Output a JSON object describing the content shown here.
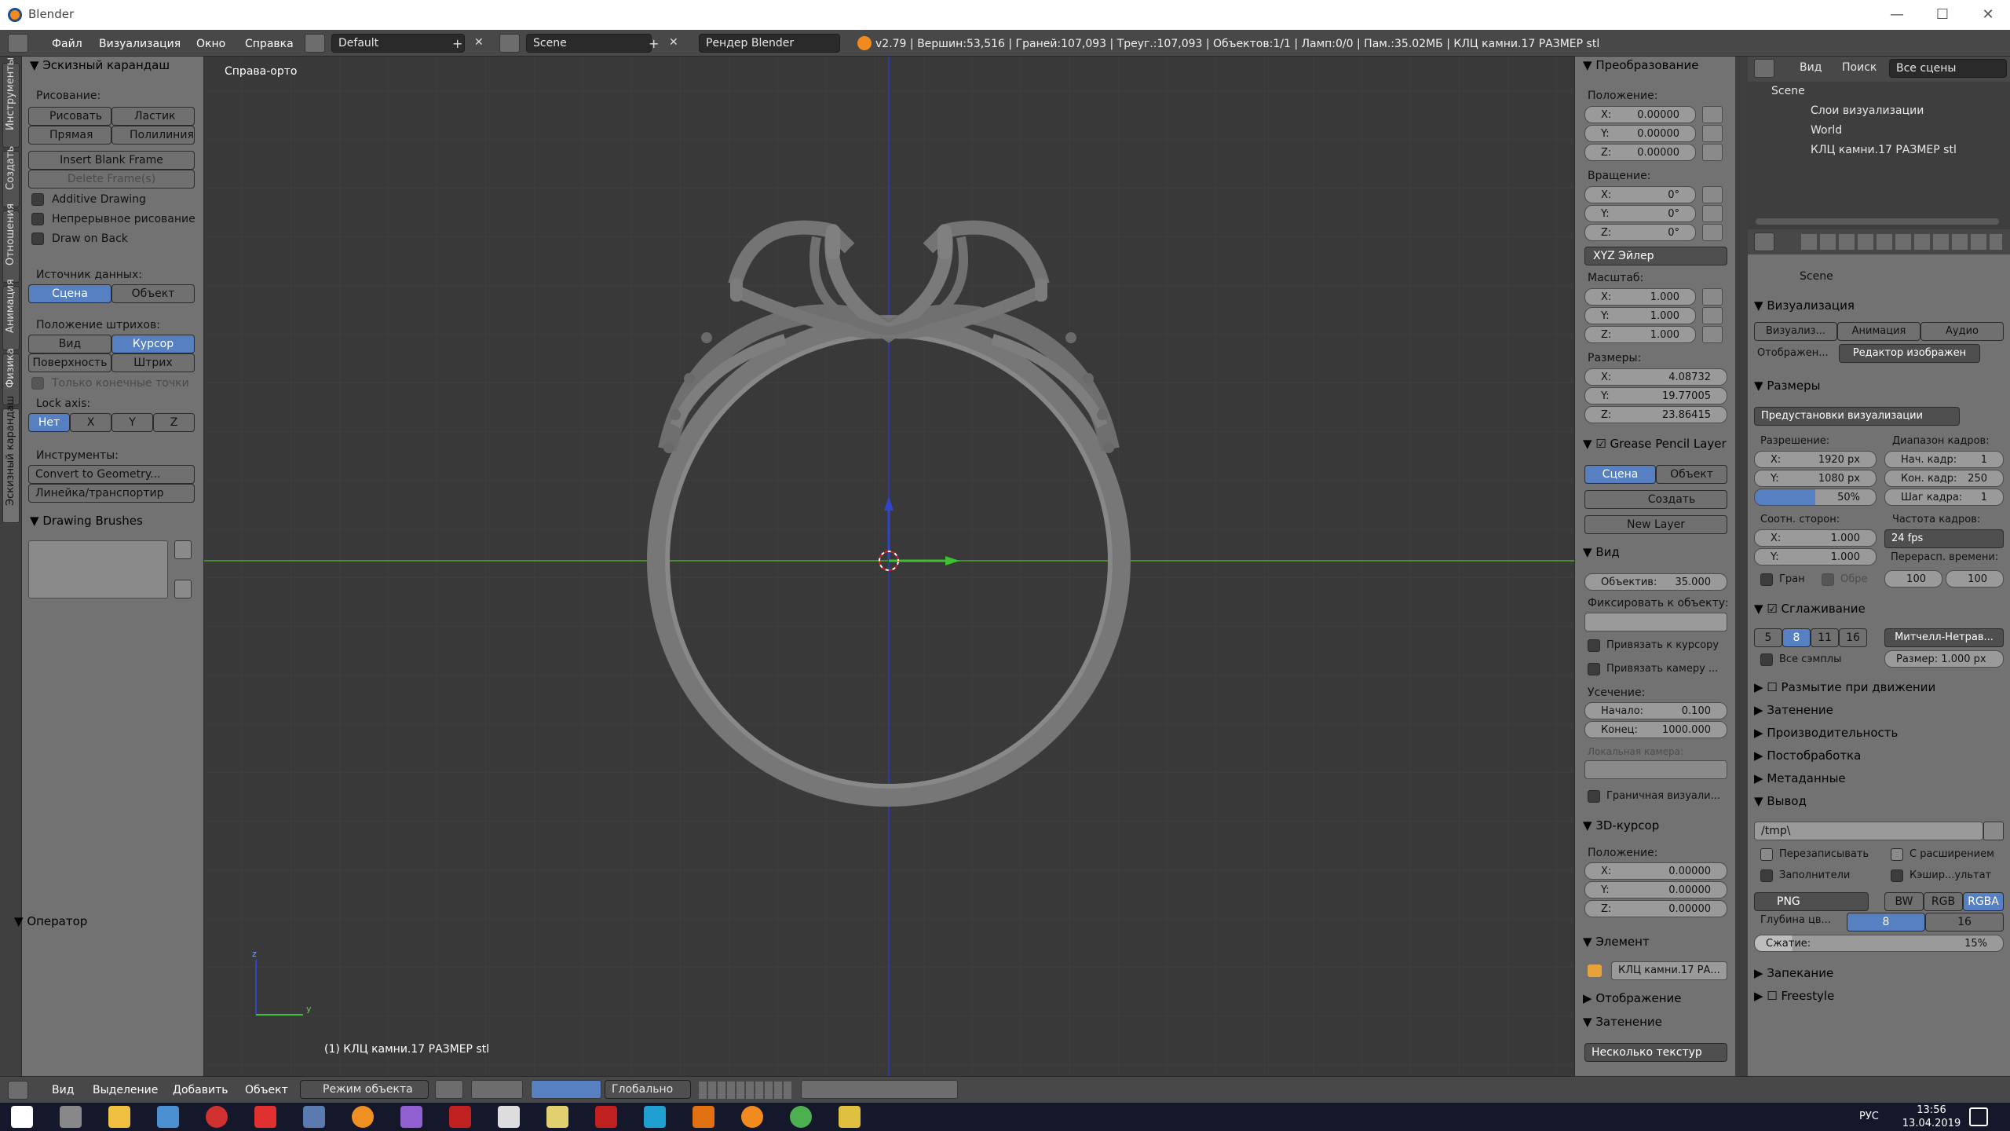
{
  "window": {
    "title": "Blender",
    "min": "—",
    "max": "☐",
    "close": "✕"
  },
  "menu": {
    "file": "Файл",
    "render": "Визуализация",
    "window": "Окно",
    "help": "Справка"
  },
  "layout": "Default",
  "scene": "Scene",
  "engine": "Рендер Blender",
  "stats": "v2.79 | Вершин:53,516 | Граней:107,093 | Треуг.:107,093 | Объектов:1/1 | Ламп:0/0 | Пам.:35.02МБ | КЛЦ камни.17 РАЗМЕР stl",
  "tabs": [
    "Инструменты",
    "Создать",
    "Отношения",
    "Анимация",
    "Физика",
    "Эскизный карандаш"
  ],
  "left": {
    "panel_title": "Эскизный карандаш",
    "draw_label": "Рисование:",
    "draw": "Рисовать",
    "erase": "Ластик",
    "line": "Прямая",
    "poly": "Полилиния",
    "insert": "Insert Blank Frame",
    "delete": "Delete Frame(s)",
    "additive": "Additive Drawing",
    "continuous": "Непрерывное рисование",
    "drawback": "Draw on Back",
    "src_label": "Источник данных:",
    "scene": "Сцена",
    "object": "Объект",
    "stroke_label": "Положение штрихов:",
    "view": "Вид",
    "cursor": "Курсор",
    "surface": "Поверхность",
    "stroke": "Штрих",
    "endpoints": "Только конечные точки",
    "lock_label": "Lock axis:",
    "none": "Нет",
    "x": "X",
    "y": "Y",
    "z": "Z",
    "tools_label": "Инструменты:",
    "convert": "Convert to Geometry...",
    "ruler": "Линейка/транспортир",
    "brushes": "Drawing Brushes",
    "operator": "Оператор"
  },
  "viewport": {
    "view_name": "Справа-орто",
    "object_label": "(1) КЛЦ камни.17 РАЗМЕР stl",
    "axis_z": "z",
    "axis_y": "y"
  },
  "n": {
    "transform": "Преобразование",
    "location": "Положение:",
    "lx": "0.00000",
    "ly": "0.00000",
    "lz": "0.00000",
    "rotation": "Вращение:",
    "rx": "0°",
    "ry": "0°",
    "rz": "0°",
    "rotmode": "XYZ Эйлер",
    "scale": "Масштаб:",
    "sx": "1.000",
    "sy": "1.000",
    "sz": "1.000",
    "dims": "Размеры:",
    "dx": "4.08732",
    "dy": "19.77005",
    "dz": "23.86415",
    "gp": "Grease Pencil Layer",
    "scene": "Сцена",
    "object": "Объект",
    "create": "Создать",
    "newlayer": "New Layer",
    "view": "Вид",
    "lens": "Объектив:",
    "lensv": "35.000",
    "lockobj": "Фиксировать к объекту:",
    "lockcursor": "Привязать к курсору",
    "lockcam": "Привязать камеру ...",
    "clip": "Усечение:",
    "start": "Начало:",
    "startv": "0.100",
    "end": "Конец:",
    "endv": "1000.000",
    "localcam": "Локальная камера:",
    "border": "Граничная визуали...",
    "cursor3d": "3D-курсор",
    "cloc": "Положение:",
    "cx": "0.00000",
    "cy": "0.00000",
    "cz": "0.00000",
    "item": "Элемент",
    "itemname": "КЛЦ камни.17 РА...",
    "display": "Отображение",
    "shading": "Затенение",
    "textures": "Несколько текстур",
    "X": "X:",
    "Y": "Y:",
    "Z": "Z:"
  },
  "outliner": {
    "view": "Вид",
    "search": "Поиск",
    "allscenes": "Все сцены",
    "scene": "Scene",
    "layers": "Слои визуализации",
    "world": "World",
    "obj": "КЛЦ камни.17 РАЗМЕР stl"
  },
  "props": {
    "scene": "Scene",
    "render": "Визуализация",
    "render_btn": "Визуализ...",
    "anim_btn": "Анимация",
    "audio_btn": "Аудио",
    "display": "Отображен...",
    "editor": "Редактор изображен",
    "dims": "Размеры",
    "presets": "Предустановки визуализации",
    "res": "Разрешение:",
    "resx": "1920 px",
    "resy": "1080 px",
    "pct": "50%",
    "frange": "Диапазон кадров:",
    "fstart": "Нач. кадр:",
    "fstartv": "1",
    "fend": "Кон. кадр:",
    "fendv": "250",
    "fstep": "Шаг кадра:",
    "fstepv": "1",
    "aspect": "Соотн. сторон:",
    "ax": "1.000",
    "ay": "1.000",
    "fps_label": "Частота кадров:",
    "fps": "24 fps",
    "remap": "Перерасп. времени:",
    "r1": "100",
    "r2": "100",
    "border": "Гран",
    "crop": "Обре",
    "aa": "Сглаживание",
    "s5": "5",
    "s8": "8",
    "s11": "11",
    "s16": "16",
    "filter": "Митчелл-Нетрав...",
    "fullsample": "Все сэмплы",
    "size": "Размер: 1.000 px",
    "motion": "Размытие при движении",
    "shading": "Затенение",
    "perf": "Производительность",
    "post": "Постобработка",
    "meta": "Метаданные",
    "output": "Вывод",
    "path": "/tmp\\",
    "overwrite": "Перезаписывать",
    "ext": "С расширением",
    "placeholders": "Заполнители",
    "cache": "Кэшир...ультат",
    "png": "PNG",
    "bw": "BW",
    "rgb": "RGB",
    "rgba": "RGBA",
    "depth": "Глубина цв...",
    "d8": "8",
    "d16": "16",
    "compress": "Сжатие:",
    "compressv": "15%",
    "bake": "Запекание",
    "freestyle": "Freestyle"
  },
  "bottom": {
    "view": "Вид",
    "select": "Выделение",
    "add": "Добавить",
    "object": "Объект",
    "mode": "Режим объекта",
    "orient": "Глобально"
  },
  "taskbar": {
    "time": "13:56",
    "date": "13.04.2019",
    "lang": "РУС"
  }
}
